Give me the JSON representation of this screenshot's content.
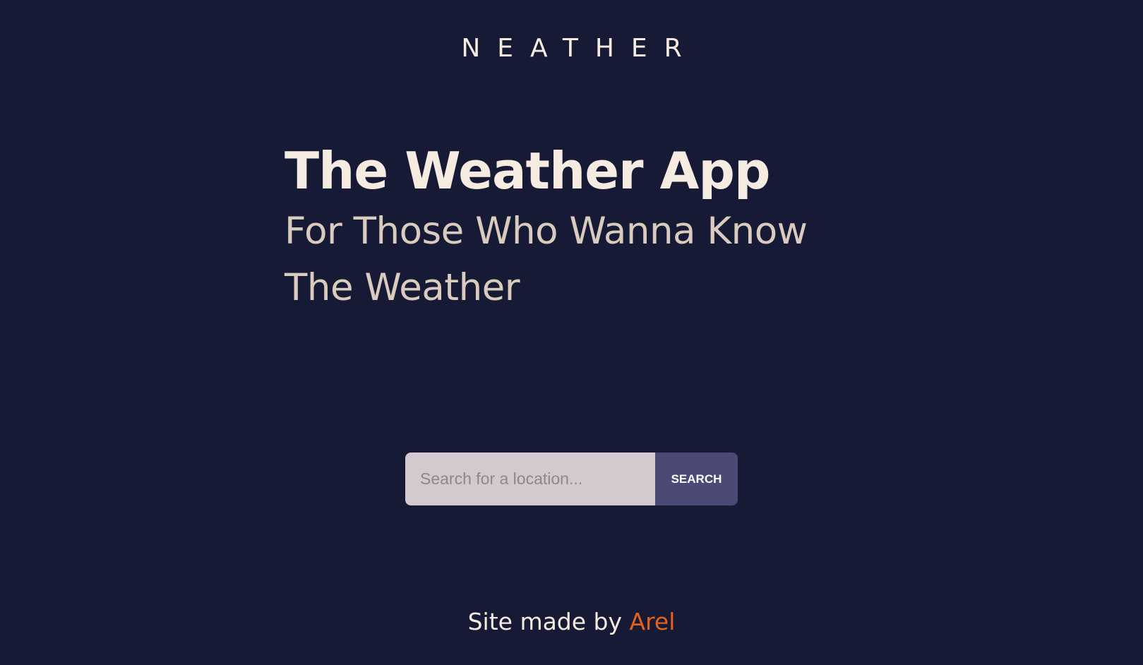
{
  "header": {
    "brand": "NEATHER"
  },
  "hero": {
    "title": "The Weather App",
    "subtitle": "For Those Who Wanna Know The Weather"
  },
  "search": {
    "placeholder": "Search for a location...",
    "value": "",
    "button_label": "SEARCH"
  },
  "footer": {
    "prefix": "Site made by ",
    "author": "Arel"
  },
  "colors": {
    "background": "#171a35",
    "text_primary": "#f6ebe0",
    "text_secondary": "#dacbbf",
    "input_background": "#d4c9cf",
    "button_background": "#4b4a77",
    "accent": "#e0621d"
  }
}
